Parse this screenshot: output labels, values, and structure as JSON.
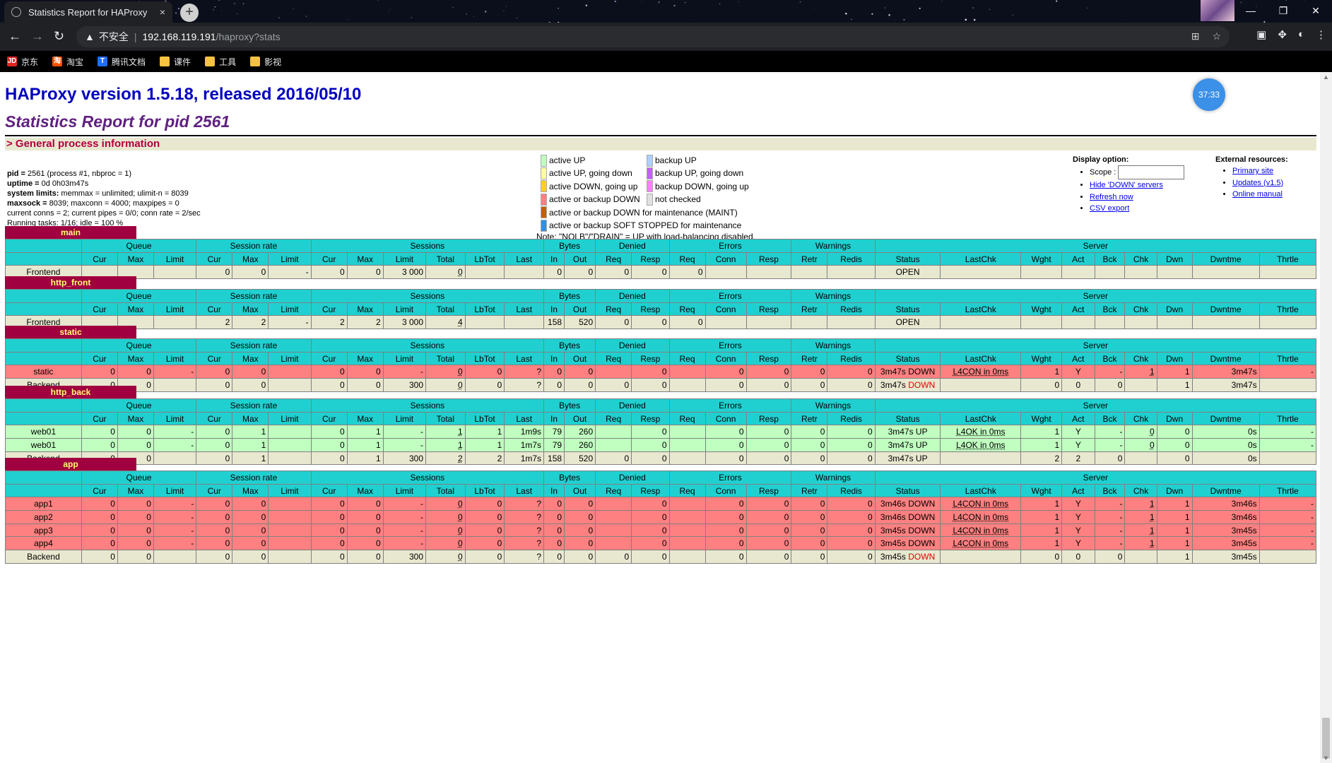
{
  "browser": {
    "tab_title": "Statistics Report for HAProxy",
    "tab_close": "×",
    "new_tab": "+",
    "security_label": "不安全",
    "url_domain": "192.168.119.191",
    "url_path": "/haproxy?stats",
    "bookmarks": [
      {
        "label": "京东",
        "icon": "JD",
        "color": "#e1251b"
      },
      {
        "label": "淘宝",
        "icon": "淘",
        "color": "#ff5000"
      },
      {
        "label": "腾讯文档",
        "icon": "T",
        "color": "#1e6fff"
      },
      {
        "label": "课件",
        "icon": "folder",
        "color": "#f5c242"
      },
      {
        "label": "工具",
        "icon": "folder",
        "color": "#f5c242"
      },
      {
        "label": "影视",
        "icon": "folder",
        "color": "#f5c242"
      }
    ]
  },
  "page": {
    "title": "HAProxy version 1.5.18, released 2016/05/10",
    "subtitle": "Statistics Report for pid 2561",
    "clock": "37:33",
    "general_header": "> General process information",
    "process_info": [
      {
        "b": "pid = ",
        "t": "2561 (process #1, nbproc = 1)"
      },
      {
        "b": "uptime = ",
        "t": "0d 0h03m47s"
      },
      {
        "b": "system limits:",
        "t": " memmax = unlimited; ulimit-n = 8039"
      },
      {
        "b": "maxsock = ",
        "t": "8039; maxconn = 4000; maxpipes = 0"
      },
      {
        "b": "",
        "t": "current conns = 2; current pipes = 0/0; conn rate = 2/sec"
      },
      {
        "b": "",
        "t": "Running tasks: 1/16; idle = 100 %"
      }
    ],
    "legend": [
      {
        "left": {
          "color": "#c0ffc0",
          "label": "active UP"
        },
        "right": {
          "color": "#b0d0ff",
          "label": "backup UP"
        }
      },
      {
        "left": {
          "color": "#ffffa0",
          "label": "active UP, going down"
        },
        "right": {
          "color": "#c060ff",
          "label": "backup UP, going down"
        }
      },
      {
        "left": {
          "color": "#ffd020",
          "label": "active DOWN, going up"
        },
        "right": {
          "color": "#ff80ff",
          "label": "backup DOWN, going up"
        }
      },
      {
        "left": {
          "color": "#ff8080",
          "label": "active or backup DOWN"
        },
        "right": {
          "color": "#e0e0e0",
          "label": "not checked"
        }
      },
      {
        "left": {
          "color": "#c06000",
          "label": "active or backup DOWN for maintenance (MAINT)"
        },
        "right": null
      },
      {
        "left": {
          "color": "#3090e0",
          "label": "active or backup SOFT STOPPED for maintenance"
        },
        "right": null
      }
    ],
    "legend_note": "Note: \"NOLB\"/\"DRAIN\" = UP with load-balancing disabled.",
    "display_option": {
      "title": "Display option:",
      "scope_label": "Scope :",
      "links": [
        "Hide 'DOWN' servers",
        "Refresh now",
        "CSV export"
      ]
    },
    "external_resources": {
      "title": "External resources:",
      "links": [
        "Primary site",
        "Updates (v1.5)",
        "Online manual"
      ]
    }
  },
  "group_headers": [
    "Queue",
    "Session rate",
    "Sessions",
    "Bytes",
    "Denied",
    "Errors",
    "Warnings",
    "Server"
  ],
  "column_headers": [
    "Cur",
    "Max",
    "Limit",
    "Cur",
    "Max",
    "Limit",
    "Cur",
    "Max",
    "Limit",
    "Total",
    "LbTot",
    "Last",
    "In",
    "Out",
    "Req",
    "Resp",
    "Req",
    "Conn",
    "Resp",
    "Retr",
    "Redis",
    "Status",
    "LastChk",
    "Wght",
    "Act",
    "Bck",
    "Chk",
    "Dwn",
    "Dwntme",
    "Thrtle"
  ],
  "proxies": [
    {
      "name": "main",
      "rows": [
        {
          "cls": "fe",
          "cells": [
            "Frontend",
            "",
            "",
            "",
            "0",
            "0",
            "-",
            "0",
            "0",
            "3 000",
            "0",
            "",
            "",
            "0",
            "0",
            "0",
            "0",
            "0",
            "",
            "",
            "",
            "",
            "OPEN",
            "",
            "",
            "",
            "",
            "",
            "",
            "",
            ""
          ]
        }
      ]
    },
    {
      "name": "http_front",
      "rows": [
        {
          "cls": "fe",
          "cells": [
            "Frontend",
            "",
            "",
            "",
            "2",
            "2",
            "-",
            "2",
            "2",
            "3 000",
            "4",
            "",
            "",
            "158",
            "520",
            "0",
            "0",
            "0",
            "",
            "",
            "",
            "",
            "OPEN",
            "",
            "",
            "",
            "",
            "",
            "",
            "",
            ""
          ]
        }
      ]
    },
    {
      "name": "static",
      "rows": [
        {
          "cls": "down",
          "cells": [
            "static",
            "0",
            "0",
            "-",
            "0",
            "0",
            "",
            "0",
            "0",
            "-",
            "0",
            "0",
            "?",
            "0",
            "0",
            "",
            "0",
            "",
            "0",
            "0",
            "0",
            "0",
            "3m47s DOWN",
            "L4CON in 0ms",
            "1",
            "Y",
            "-",
            "1",
            "1",
            "3m47s",
            "-"
          ]
        },
        {
          "cls": "be",
          "cells": [
            "Backend",
            "0",
            "0",
            "",
            "0",
            "0",
            "",
            "0",
            "0",
            "300",
            "0",
            "0",
            "?",
            "0",
            "0",
            "0",
            "0",
            "",
            "0",
            "0",
            "0",
            "0",
            "3m47s DOWN",
            "",
            "0",
            "0",
            "0",
            "",
            "1",
            "3m47s",
            ""
          ]
        }
      ]
    },
    {
      "name": "http_back",
      "rows": [
        {
          "cls": "up",
          "cells": [
            "web01",
            "0",
            "0",
            "-",
            "0",
            "1",
            "",
            "0",
            "1",
            "-",
            "1",
            "1",
            "1m9s",
            "79",
            "260",
            "",
            "0",
            "",
            "0",
            "0",
            "0",
            "0",
            "3m47s UP",
            "L4OK in 0ms",
            "1",
            "Y",
            "-",
            "0",
            "0",
            "0s",
            "-"
          ]
        },
        {
          "cls": "up",
          "cells": [
            "web01",
            "0",
            "0",
            "-",
            "0",
            "1",
            "",
            "0",
            "1",
            "-",
            "1",
            "1",
            "1m7s",
            "79",
            "260",
            "",
            "0",
            "",
            "0",
            "0",
            "0",
            "0",
            "3m47s UP",
            "L4OK in 0ms",
            "1",
            "Y",
            "-",
            "0",
            "0",
            "0s",
            "-"
          ]
        },
        {
          "cls": "be",
          "cells": [
            "Backend",
            "0",
            "0",
            "",
            "0",
            "1",
            "",
            "0",
            "1",
            "300",
            "2",
            "2",
            "1m7s",
            "158",
            "520",
            "0",
            "0",
            "",
            "0",
            "0",
            "0",
            "0",
            "3m47s UP",
            "",
            "2",
            "2",
            "0",
            "",
            "0",
            "0s",
            ""
          ]
        }
      ]
    },
    {
      "name": "app",
      "rows": [
        {
          "cls": "down",
          "cells": [
            "app1",
            "0",
            "0",
            "-",
            "0",
            "0",
            "",
            "0",
            "0",
            "-",
            "0",
            "0",
            "?",
            "0",
            "0",
            "",
            "0",
            "",
            "0",
            "0",
            "0",
            "0",
            "3m46s DOWN",
            "L4CON in 0ms",
            "1",
            "Y",
            "-",
            "1",
            "1",
            "3m46s",
            "-"
          ]
        },
        {
          "cls": "down",
          "cells": [
            "app2",
            "0",
            "0",
            "-",
            "0",
            "0",
            "",
            "0",
            "0",
            "-",
            "0",
            "0",
            "?",
            "0",
            "0",
            "",
            "0",
            "",
            "0",
            "0",
            "0",
            "0",
            "3m46s DOWN",
            "L4CON in 0ms",
            "1",
            "Y",
            "-",
            "1",
            "1",
            "3m46s",
            "-"
          ]
        },
        {
          "cls": "down",
          "cells": [
            "app3",
            "0",
            "0",
            "-",
            "0",
            "0",
            "",
            "0",
            "0",
            "-",
            "0",
            "0",
            "?",
            "0",
            "0",
            "",
            "0",
            "",
            "0",
            "0",
            "0",
            "0",
            "3m45s DOWN",
            "L4CON in 0ms",
            "1",
            "Y",
            "-",
            "1",
            "1",
            "3m45s",
            "-"
          ]
        },
        {
          "cls": "down",
          "cells": [
            "app4",
            "0",
            "0",
            "-",
            "0",
            "0",
            "",
            "0",
            "0",
            "-",
            "0",
            "0",
            "?",
            "0",
            "0",
            "",
            "0",
            "",
            "0",
            "0",
            "0",
            "0",
            "3m45s DOWN",
            "L4CON in 0ms",
            "1",
            "Y",
            "-",
            "1",
            "1",
            "3m45s",
            "-"
          ]
        },
        {
          "cls": "be",
          "cells": [
            "Backend",
            "0",
            "0",
            "",
            "0",
            "0",
            "",
            "0",
            "0",
            "300",
            "0",
            "0",
            "?",
            "0",
            "0",
            "0",
            "0",
            "",
            "0",
            "0",
            "0",
            "0",
            "3m45s DOWN",
            "",
            "0",
            "0",
            "0",
            "",
            "1",
            "3m45s",
            ""
          ]
        }
      ]
    }
  ]
}
